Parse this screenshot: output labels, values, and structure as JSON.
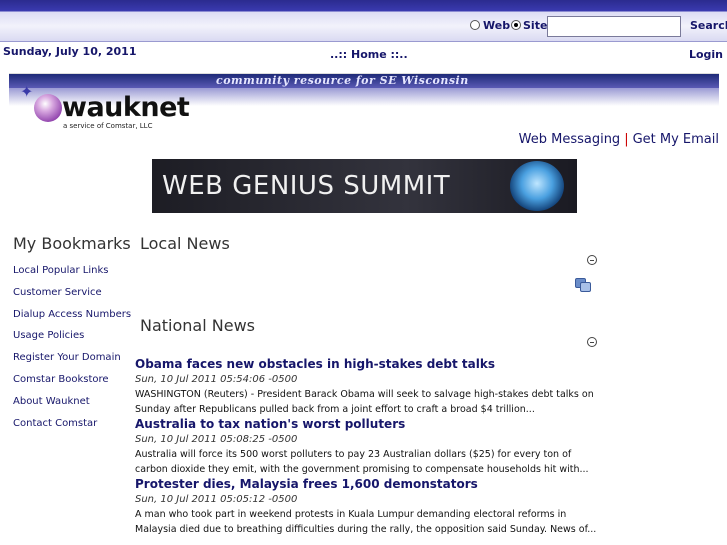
{
  "topbar": {
    "radio_web": "Web",
    "radio_site": "Site",
    "search_placeholder": "",
    "search_button": "Search"
  },
  "header": {
    "date": "Sunday, July 10, 2011",
    "home": "..:: Home ::..",
    "login": "Login"
  },
  "banner": {
    "tagline": "community resource for SE Wisconsin",
    "logo_name": "wauknet",
    "logo_sub": "a service of Comstar, LLC"
  },
  "weblinks": {
    "messaging": "Web Messaging",
    "separator": "|",
    "email": "Get My Email"
  },
  "ad": {
    "text": "WEB GENIUS SUMMIT"
  },
  "sidebar": {
    "title": "My Bookmarks",
    "items": [
      {
        "label": "Local Popular Links"
      },
      {
        "label": "Customer Service"
      },
      {
        "label": "Dialup Access Numbers"
      },
      {
        "label": "Usage Policies"
      },
      {
        "label": "Register Your Domain"
      },
      {
        "label": "Comstar Bookstore"
      },
      {
        "label": "About Wauknet"
      },
      {
        "label": "Contact Comstar"
      }
    ]
  },
  "local_news": {
    "title": "Local News"
  },
  "national_news": {
    "title": "National News",
    "items": [
      {
        "headline": "Obama faces new obstacles in high-stakes debt talks",
        "date": "Sun, 10 Jul 2011 05:54:06 -0500",
        "summary": "WASHINGTON (Reuters) - President Barack Obama will seek to salvage high-stakes debt talks on Sunday after Republicans pulled back from a joint effort to craft a broad $4 trillion..."
      },
      {
        "headline": "Australia to tax nation's worst polluters",
        "date": "Sun, 10 Jul 2011 05:08:25 -0500",
        "summary": "Australia will force its 500 worst polluters to pay 23 Australian dollars ($25) for every ton of carbon dioxide they emit, with the government promising to compensate households hit with..."
      },
      {
        "headline": "Protester dies, Malaysia frees 1,600 demonstators",
        "date": "Sun, 10 Jul 2011 05:05:12 -0500",
        "summary": "A man who took part in weekend protests in Kuala Lumpur demanding electoral reforms in Malaysia died due to breathing difficulties during the rally, the opposition said Sunday. News of..."
      }
    ]
  }
}
